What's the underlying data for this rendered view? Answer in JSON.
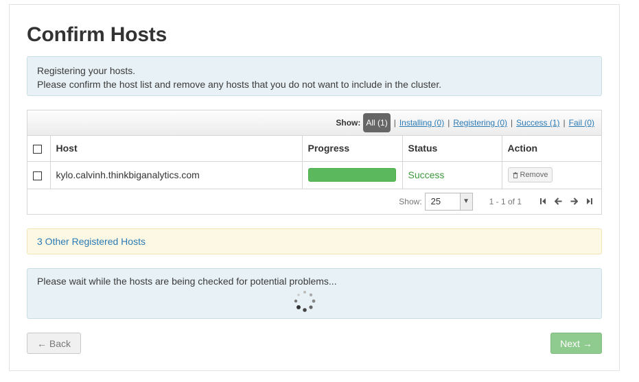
{
  "page": {
    "title": "Confirm Hosts"
  },
  "info": {
    "line1": "Registering your hosts.",
    "line2": "Please confirm the host list and remove any hosts that you do not want to include in the cluster."
  },
  "filter": {
    "show_label": "Show:",
    "options": [
      "All (1)",
      "Installing (0)",
      "Registering (0)",
      "Success (1)",
      "Fail (0)"
    ],
    "separator": "|"
  },
  "table": {
    "columns": [
      "Host",
      "Progress",
      "Status",
      "Action"
    ],
    "rows": [
      {
        "host": "kylo.calvinh.thinkbiganalytics.com",
        "progress": 1.0,
        "status": "Success",
        "action": "Remove"
      }
    ]
  },
  "pager": {
    "show_label": "Show:",
    "page_size": "25",
    "range": "1 - 1 of 1"
  },
  "other_hosts": {
    "link": "3 Other Registered Hosts"
  },
  "wait": {
    "message": "Please wait while the hosts are being checked for potential problems..."
  },
  "buttons": {
    "back": "← Back",
    "next": "Next →"
  },
  "colors": {
    "success": "#5cb85c",
    "link": "#2a7ab5",
    "info_bg": "#e8f1f5",
    "warning_bg": "#fcf8e3"
  },
  "icons": {
    "remove": "trash-icon",
    "pager": [
      "first-page-icon",
      "prev-page-icon",
      "next-page-icon",
      "last-page-icon"
    ],
    "loading": "spinner-icon"
  }
}
